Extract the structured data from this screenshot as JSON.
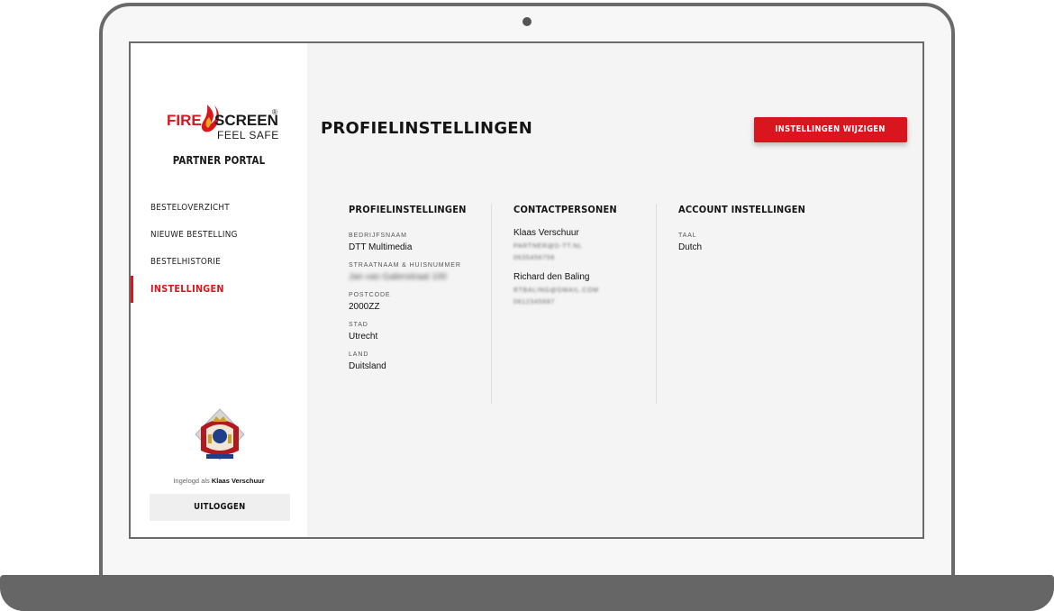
{
  "brand": {
    "logo_fire": "FIRE",
    "logo_screen": "SCREEN",
    "logo_registered": "®",
    "logo_tagline": "FEEL SAFE",
    "portal_name": "PARTNER PORTAL",
    "accent_color": "#d9161d"
  },
  "sidebar": {
    "items": [
      {
        "label": "BESTELOVERZICHT",
        "active": false
      },
      {
        "label": "NIEUWE BESTELLING",
        "active": false
      },
      {
        "label": "BESTELHISTORIE",
        "active": false
      },
      {
        "label": "INSTELLINGEN",
        "active": true
      }
    ],
    "logged_in_prefix": "Ingelogd als",
    "logged_in_user": "Klaas Verschuur",
    "logout_label": "UITLOGGEN"
  },
  "main": {
    "title": "PROFIELINSTELLINGEN",
    "edit_button": "INSTELLINGEN WIJZIGEN",
    "profile": {
      "heading": "PROFIELINSTELLINGEN",
      "fields": [
        {
          "label": "BEDRIJFSNAAM",
          "value": "DTT Multimedia",
          "blurred": false
        },
        {
          "label": "STRAATNAAM & HUISNUMMER",
          "value": "Jan van Galenstraat 100",
          "blurred": true
        },
        {
          "label": "POSTCODE",
          "value": "2000ZZ",
          "blurred": false
        },
        {
          "label": "STAD",
          "value": "Utrecht",
          "blurred": false
        },
        {
          "label": "LAND",
          "value": "Duitsland",
          "blurred": false
        }
      ]
    },
    "contacts": {
      "heading": "CONTACTPERSONEN",
      "people": [
        {
          "name": "Klaas Verschuur",
          "email": "PARTNER@D-TT.NL",
          "phone": "0635456756"
        },
        {
          "name": "Richard den Baling",
          "email": "RTBALING@GMAIL.COM",
          "phone": "0612345687"
        }
      ]
    },
    "account": {
      "heading": "ACCOUNT INSTELLINGEN",
      "fields": [
        {
          "label": "TAAL",
          "value": "Dutch"
        }
      ]
    }
  }
}
